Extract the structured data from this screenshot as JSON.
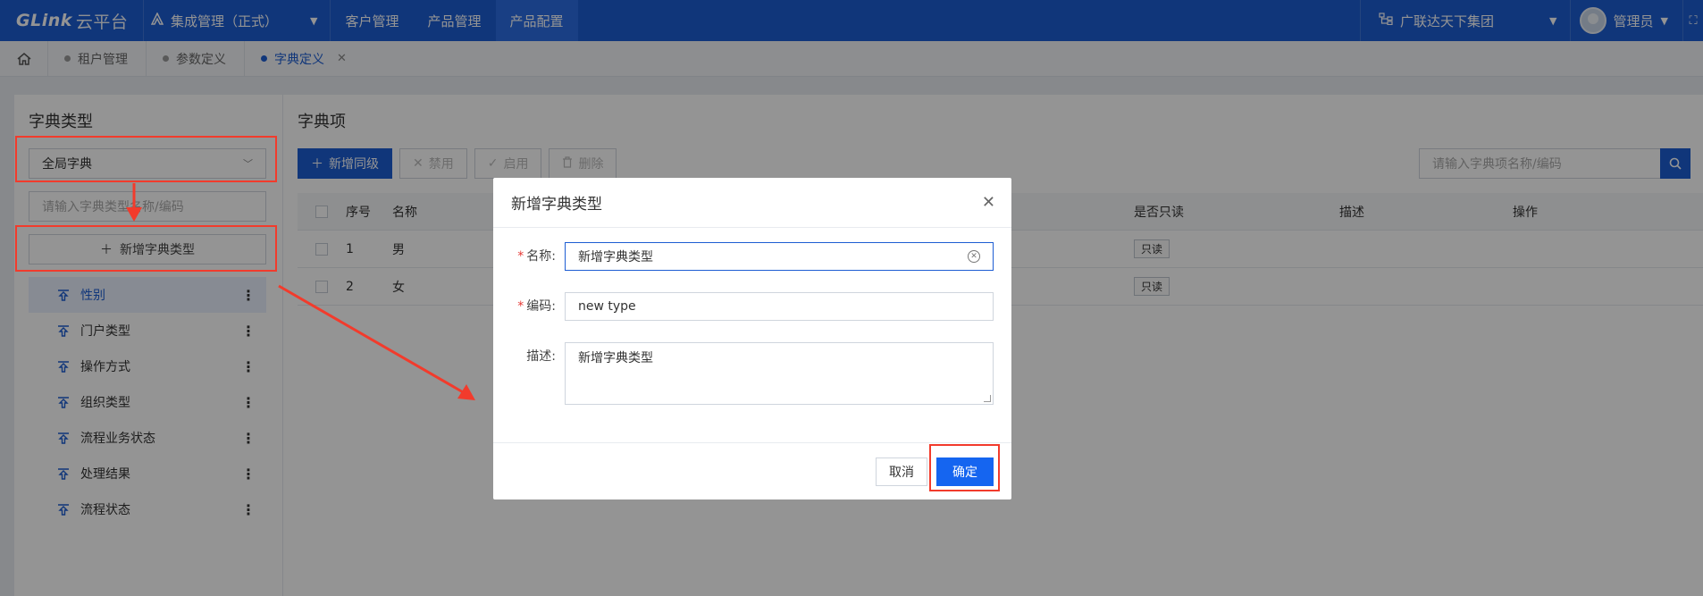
{
  "topbar": {
    "logo": "GLink",
    "logo_sub": "云平台",
    "project": "集成管理（正式）",
    "nav": [
      "客户管理",
      "产品管理",
      "产品配置"
    ],
    "org": "广联达天下集团",
    "user": "管理员"
  },
  "tabs": [
    {
      "label": "租户管理"
    },
    {
      "label": "参数定义"
    },
    {
      "label": "字典定义"
    }
  ],
  "left": {
    "title": "字典类型",
    "select_value": "全局字典",
    "search_placeholder": "请输入字典类型名称/编码",
    "add_label": "新增字典类型",
    "items": [
      "性别",
      "门户类型",
      "操作方式",
      "组织类型",
      "流程业务状态",
      "处理结果",
      "流程状态"
    ]
  },
  "right": {
    "title": "字典项",
    "toolbar": {
      "add": "新增同级",
      "disable": "禁用",
      "enable": "启用",
      "delete": "删除"
    },
    "search_placeholder": "请输入字典项名称/编码",
    "headers": {
      "no": "序号",
      "name": "名称",
      "readonly": "是否只读",
      "desc": "描述",
      "op": "操作"
    },
    "rows": [
      {
        "no": "1",
        "name": "男",
        "readonly": "只读"
      },
      {
        "no": "2",
        "name": "女",
        "readonly": "只读"
      }
    ]
  },
  "modal": {
    "title": "新增字典类型",
    "name_label": "名称:",
    "name_value": "新增字典类型",
    "code_label": "编码:",
    "code_value": "new type",
    "desc_label": "描述:",
    "desc_value": "新增字典类型",
    "cancel": "取消",
    "ok": "确定"
  },
  "colors": {
    "primary": "#1d5dd3",
    "annotation": "#f23b2c"
  }
}
